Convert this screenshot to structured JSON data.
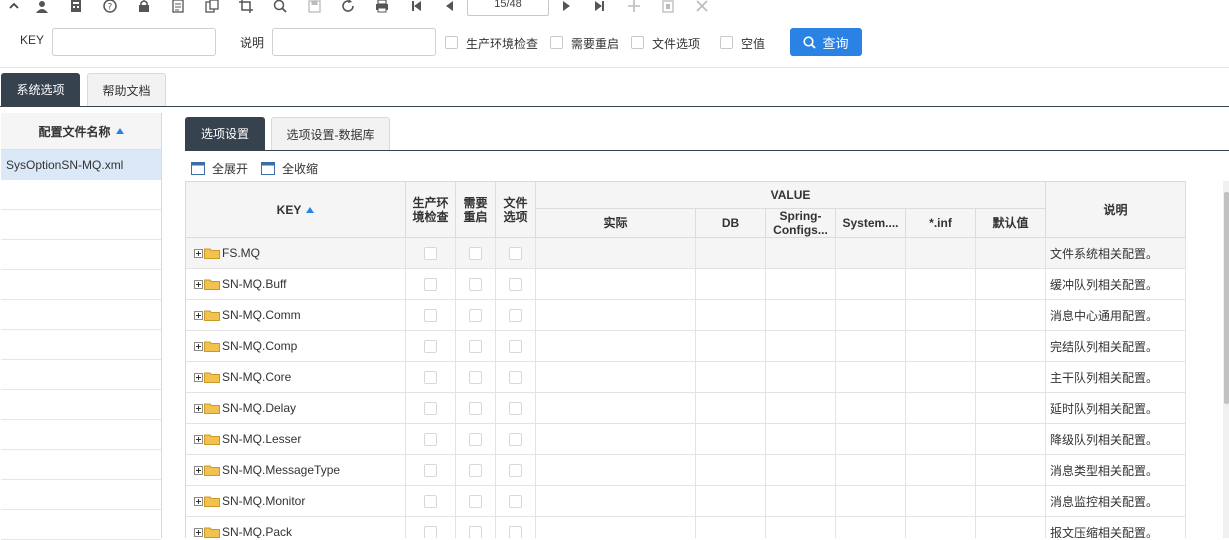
{
  "toolbar": {
    "icons": [
      "chevron-up-icon",
      "user-icon",
      "calculator-icon",
      "help-icon",
      "lock-icon",
      "document-icon",
      "copy-icon",
      "crop-icon",
      "search-icon",
      "save-icon",
      "refresh-icon",
      "print-icon",
      "first-page-icon",
      "prev-page-icon",
      "next-page-icon",
      "last-page-icon",
      "add-icon",
      "delete-icon",
      "close-icon"
    ],
    "pager": "15/48"
  },
  "filter": {
    "key_label": "KEY",
    "key_value": "",
    "desc_label": "说明",
    "desc_value": "",
    "checkboxes": [
      "生产环境检查",
      "需要重启",
      "文件选项",
      "空值"
    ],
    "query_button": "查询"
  },
  "top_tabs": [
    "系统选项",
    "帮助文档"
  ],
  "left_panel": {
    "header": "配置文件名称",
    "items": [
      "SysOptionSN-MQ.xml"
    ]
  },
  "inner_tabs": [
    "选项设置",
    "选项设置-数据库"
  ],
  "actions": {
    "expand_all": "全展开",
    "collapse_all": "全收缩"
  },
  "grid": {
    "headers": {
      "key": "KEY",
      "prod_check": "生产环境检查",
      "need_restart": "需要重启",
      "file_option": "文件选项",
      "value": "VALUE",
      "actual": "实际",
      "db": "DB",
      "spring": "Spring-Configs...",
      "system": "System....",
      "inf": "*.inf",
      "default": "默认值",
      "desc": "说明"
    },
    "rows": [
      {
        "key": "FS.MQ",
        "desc": "文件系统相关配置。"
      },
      {
        "key": "SN-MQ.Buff",
        "desc": "缓冲队列相关配置。"
      },
      {
        "key": "SN-MQ.Comm",
        "desc": "消息中心通用配置。"
      },
      {
        "key": "SN-MQ.Comp",
        "desc": "完结队列相关配置。"
      },
      {
        "key": "SN-MQ.Core",
        "desc": "主干队列相关配置。"
      },
      {
        "key": "SN-MQ.Delay",
        "desc": "延时队列相关配置。"
      },
      {
        "key": "SN-MQ.Lesser",
        "desc": "降级队列相关配置。"
      },
      {
        "key": "SN-MQ.MessageType",
        "desc": "消息类型相关配置。"
      },
      {
        "key": "SN-MQ.Monitor",
        "desc": "消息监控相关配置。"
      },
      {
        "key": "SN-MQ.Pack",
        "desc": "报文压缩相关配置。"
      }
    ]
  },
  "colors": {
    "accent": "#2a82e4",
    "dark_tab": "#37424f",
    "selected_row": "#dbe8f7",
    "folder": "#f2c14e"
  }
}
